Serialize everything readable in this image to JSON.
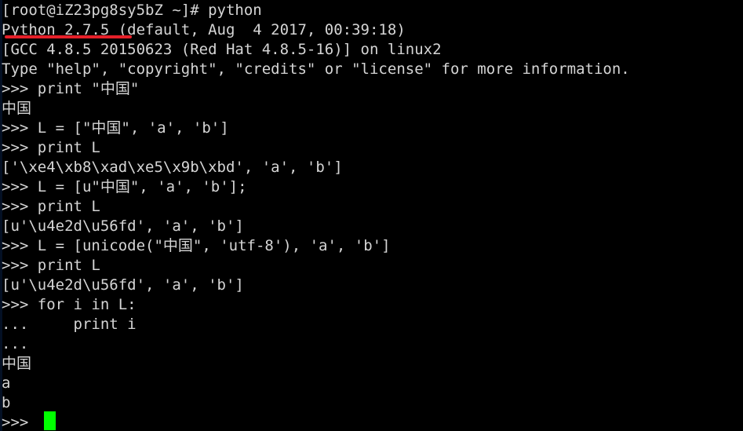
{
  "terminal": {
    "app": "ssh-terminal",
    "background_color": "#000000",
    "foreground_color": "#d5d5d5",
    "cursor_color": "#00ff00",
    "annotation_color": "#e52029",
    "columns": 69,
    "rows": 22,
    "prompt": ">>> ",
    "shell_prompt": "[root@iZ23pg8sy5bZ ~]#",
    "hostname": "iZ23pg8sy5bZ",
    "user": "root",
    "cwd": "~",
    "lines": [
      "[root@iZ23pg8sy5bZ ~]# python",
      "Python 2.7.5 (default, Aug  4 2017, 00:39:18)",
      "[GCC 4.8.5 20150623 (Red Hat 4.8.5-16)] on linux2",
      "Type \"help\", \"copyright\", \"credits\" or \"license\" for more information.",
      ">>> print \"中国\"",
      "中国",
      ">>> L = [\"中国\", 'a', 'b']",
      ">>> print L",
      "['\\xe4\\xb8\\xad\\xe5\\x9b\\xbd', 'a', 'b']",
      ">>> L = [u\"中国\", 'a', 'b'];",
      ">>> print L",
      "[u'\\u4e2d\\u56fd', 'a', 'b']",
      ">>> L = [unicode(\"中国\", 'utf-8'), 'a', 'b']",
      ">>> print L",
      "[u'\\u4e2d\\u56fd', 'a', 'b']",
      ">>> for i in L:",
      "...     print i",
      "... ",
      "中国",
      "a",
      "b",
      ">>> "
    ],
    "annotation": {
      "type": "underline",
      "target_text": "Python 2.7.5",
      "color": "#e52029"
    },
    "cursor": {
      "row": 22,
      "column": 5,
      "shape": "block",
      "color": "#00ff00"
    }
  }
}
